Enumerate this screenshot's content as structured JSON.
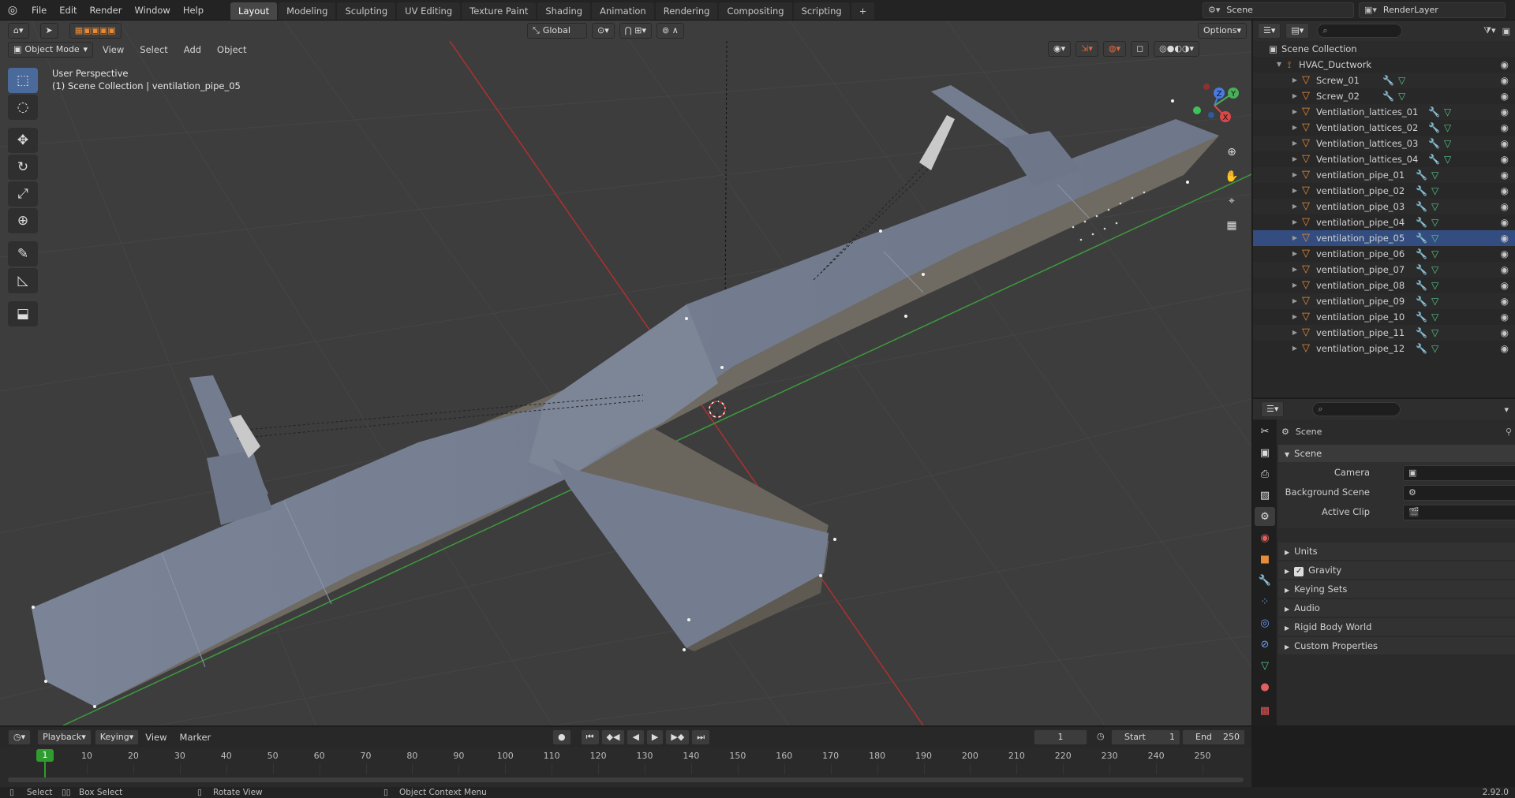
{
  "topbar": {
    "menus": [
      "File",
      "Edit",
      "Render",
      "Window",
      "Help"
    ],
    "workspace_tabs": [
      "Layout",
      "Modeling",
      "Sculpting",
      "UV Editing",
      "Texture Paint",
      "Shading",
      "Animation",
      "Rendering",
      "Compositing",
      "Scripting"
    ],
    "active_tab": "Layout",
    "add_tab": "+",
    "scene_name": "Scene",
    "view_layer": "RenderLayer"
  },
  "viewport": {
    "mode": "Object Mode",
    "menus": [
      "View",
      "Select",
      "Add",
      "Object"
    ],
    "transform_orientation": "Global",
    "options": "Options",
    "view_name": "User Perspective",
    "context": "(1) Scene Collection | ventilation_pipe_05",
    "gizmo": {
      "x": "X",
      "y": "Y",
      "z": "Z"
    }
  },
  "outliner": {
    "root": "Scene Collection",
    "collection": "HVAC_Ductwork",
    "objects": [
      "Screw_01",
      "Screw_02",
      "Ventilation_lattices_01",
      "Ventilation_lattices_02",
      "Ventilation_lattices_03",
      "Ventilation_lattices_04",
      "ventilation_pipe_01",
      "ventilation_pipe_02",
      "ventilation_pipe_03",
      "ventilation_pipe_04",
      "ventilation_pipe_05",
      "ventilation_pipe_06",
      "ventilation_pipe_07",
      "ventilation_pipe_08",
      "ventilation_pipe_09",
      "ventilation_pipe_10",
      "ventilation_pipe_11",
      "ventilation_pipe_12"
    ],
    "selected": "ventilation_pipe_05"
  },
  "properties": {
    "context": "Scene",
    "panel": "Scene",
    "fields": [
      {
        "label": "Camera"
      },
      {
        "label": "Background Scene"
      },
      {
        "label": "Active Clip"
      }
    ],
    "sections": [
      "Units",
      "Gravity",
      "Keying Sets",
      "Audio",
      "Rigid Body World",
      "Custom Properties"
    ],
    "gravity_enabled": true
  },
  "timeline": {
    "menus": [
      "Playback",
      "Keying",
      "View",
      "Marker"
    ],
    "current_frame": "1",
    "start_label": "Start",
    "start": "1",
    "end_label": "End",
    "end": "250",
    "ticks": [
      "10",
      "20",
      "30",
      "40",
      "50",
      "60",
      "70",
      "80",
      "90",
      "100",
      "110",
      "120",
      "130",
      "140",
      "150",
      "160",
      "170",
      "180",
      "190",
      "200",
      "210",
      "220",
      "230",
      "240",
      "250"
    ],
    "playhead": "1"
  },
  "statusbar": {
    "select": "Select",
    "box_select": "Box Select",
    "rotate": "Rotate View",
    "context_menu": "Object Context Menu",
    "version": "2.92.0"
  },
  "colors": {
    "accent": "#4a6a9b",
    "selection_blue": "#334d80",
    "object_orange": "#e58b3a",
    "playhead": "#2e9c2e"
  }
}
